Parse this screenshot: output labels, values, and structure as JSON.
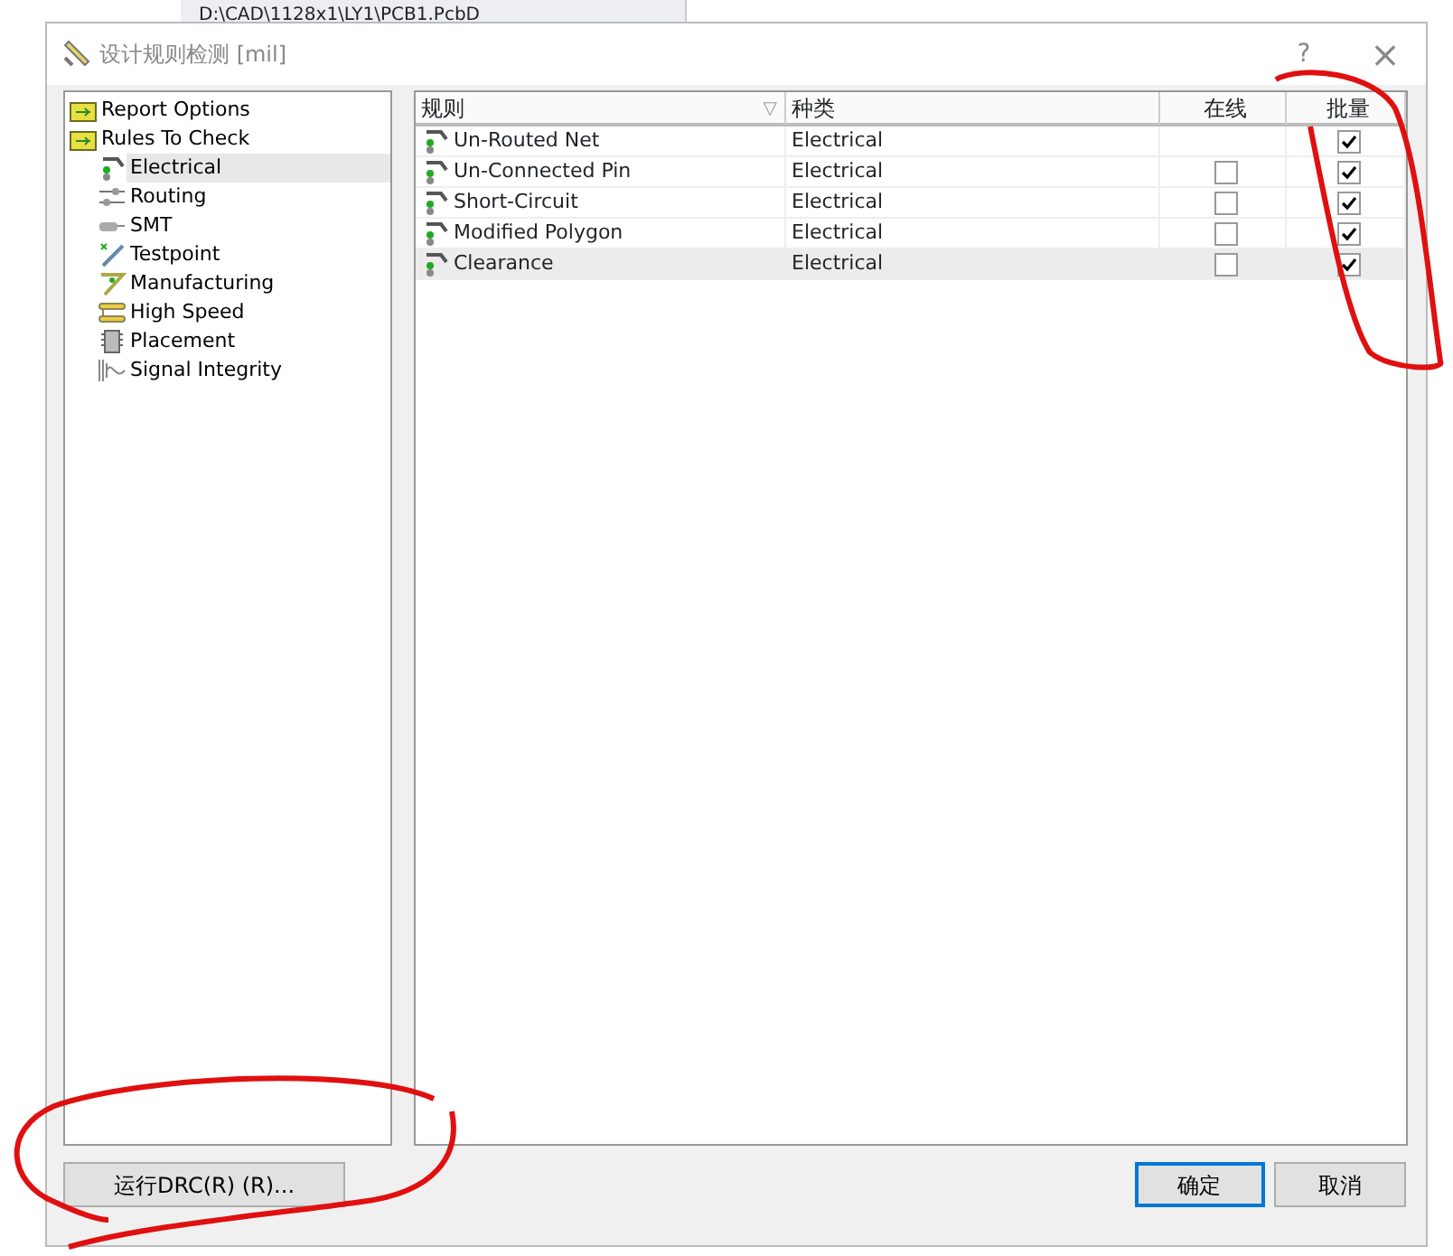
{
  "background": {
    "path": "D:\\CAD\\1128x1\\LY1\\PCB1.PcbD"
  },
  "window": {
    "title": "设计规则检测 [mil]",
    "help": "?",
    "close": "×"
  },
  "tree": [
    {
      "label": "Report Options",
      "kind": "folder",
      "selected": false
    },
    {
      "label": "Rules To Check",
      "kind": "folder",
      "selected": false,
      "children": [
        {
          "label": "Electrical",
          "kind": "electrical",
          "selected": true
        },
        {
          "label": "Routing",
          "kind": "routing",
          "selected": false
        },
        {
          "label": "SMT",
          "kind": "smt",
          "selected": false
        },
        {
          "label": "Testpoint",
          "kind": "testpoint",
          "selected": false
        },
        {
          "label": "Manufacturing",
          "kind": "manufacturing",
          "selected": false
        },
        {
          "label": "High Speed",
          "kind": "highspeed",
          "selected": false
        },
        {
          "label": "Placement",
          "kind": "placement",
          "selected": false
        },
        {
          "label": "Signal Integrity",
          "kind": "signal",
          "selected": false
        }
      ]
    }
  ],
  "table": {
    "columns": [
      "规则",
      "种类",
      "在线",
      "批量"
    ],
    "sort_mark": "▽",
    "rows": [
      {
        "rule": "Un-Routed Net",
        "type": "Electrical",
        "batch": true,
        "selected": false
      },
      {
        "rule": "Un-Connected Pin",
        "type": "Electrical",
        "online": false,
        "batch": true,
        "selected": false
      },
      {
        "rule": "Short-Circuit",
        "type": "Electrical",
        "online": false,
        "batch": true,
        "selected": false
      },
      {
        "rule": "Modified Polygon",
        "type": "Electrical",
        "online": false,
        "batch": true,
        "selected": false
      },
      {
        "rule": "Clearance",
        "type": "Electrical",
        "online": false,
        "batch": true,
        "selected": true
      }
    ]
  },
  "buttons": {
    "run": "运行DRC(R) (R)...",
    "ok": "确定",
    "cancel": "取消"
  }
}
